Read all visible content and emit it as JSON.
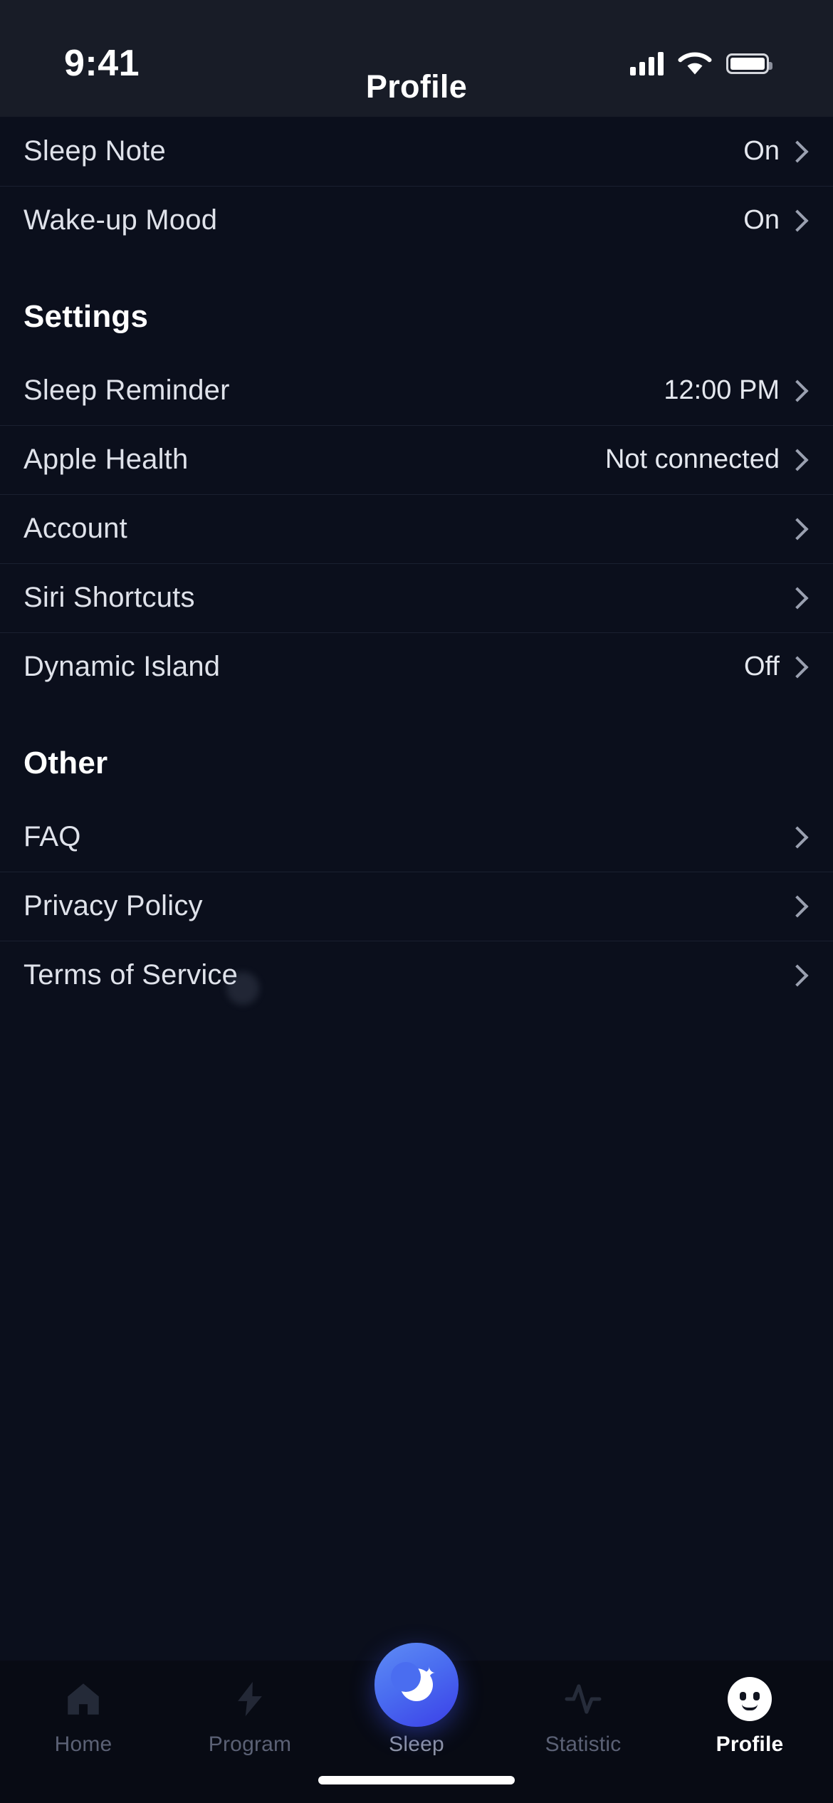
{
  "status_bar": {
    "time": "9:41",
    "cellular_icon": "cellular-signal-icon",
    "wifi_icon": "wifi-icon",
    "battery_icon": "battery-icon"
  },
  "header": {
    "title": "Profile"
  },
  "sections": [
    {
      "id": "top",
      "title": null,
      "rows": [
        {
          "label": "Sleep Note",
          "value": "On",
          "chevron": true
        },
        {
          "label": "Wake-up Mood",
          "value": "On",
          "chevron": true
        }
      ]
    },
    {
      "id": "settings",
      "title": "Settings",
      "rows": [
        {
          "label": "Sleep Reminder",
          "value": "12:00 PM",
          "chevron": true
        },
        {
          "label": "Apple Health",
          "value": "Not connected",
          "chevron": true
        },
        {
          "label": "Account",
          "value": "",
          "chevron": true
        },
        {
          "label": "Siri Shortcuts",
          "value": "",
          "chevron": true
        },
        {
          "label": "Dynamic Island",
          "value": "Off",
          "chevron": true
        }
      ]
    },
    {
      "id": "other",
      "title": "Other",
      "rows": [
        {
          "label": "FAQ",
          "value": "",
          "chevron": true
        },
        {
          "label": "Privacy Policy",
          "value": "",
          "chevron": true
        },
        {
          "label": "Terms of Service",
          "value": "",
          "chevron": true
        }
      ]
    }
  ],
  "tabbar": {
    "items": [
      {
        "label": "Home",
        "icon": "home-icon",
        "active": false
      },
      {
        "label": "Program",
        "icon": "lightning-icon",
        "active": false
      },
      {
        "label": "Sleep",
        "icon": "moon-icon",
        "active": false
      },
      {
        "label": "Statistic",
        "icon": "pulse-icon",
        "active": false
      },
      {
        "label": "Profile",
        "icon": "face-icon",
        "active": true
      }
    ]
  },
  "colors": {
    "background": "#0b0f1c",
    "header_background": "#181c27",
    "tabbar_background": "#080b14",
    "divider": "#1a2030",
    "text_primary": "#dfe2ea",
    "text_muted": "#5b6175",
    "accent_gradient_start": "#5f8cf5",
    "accent_gradient_end": "#3b3fe8"
  }
}
